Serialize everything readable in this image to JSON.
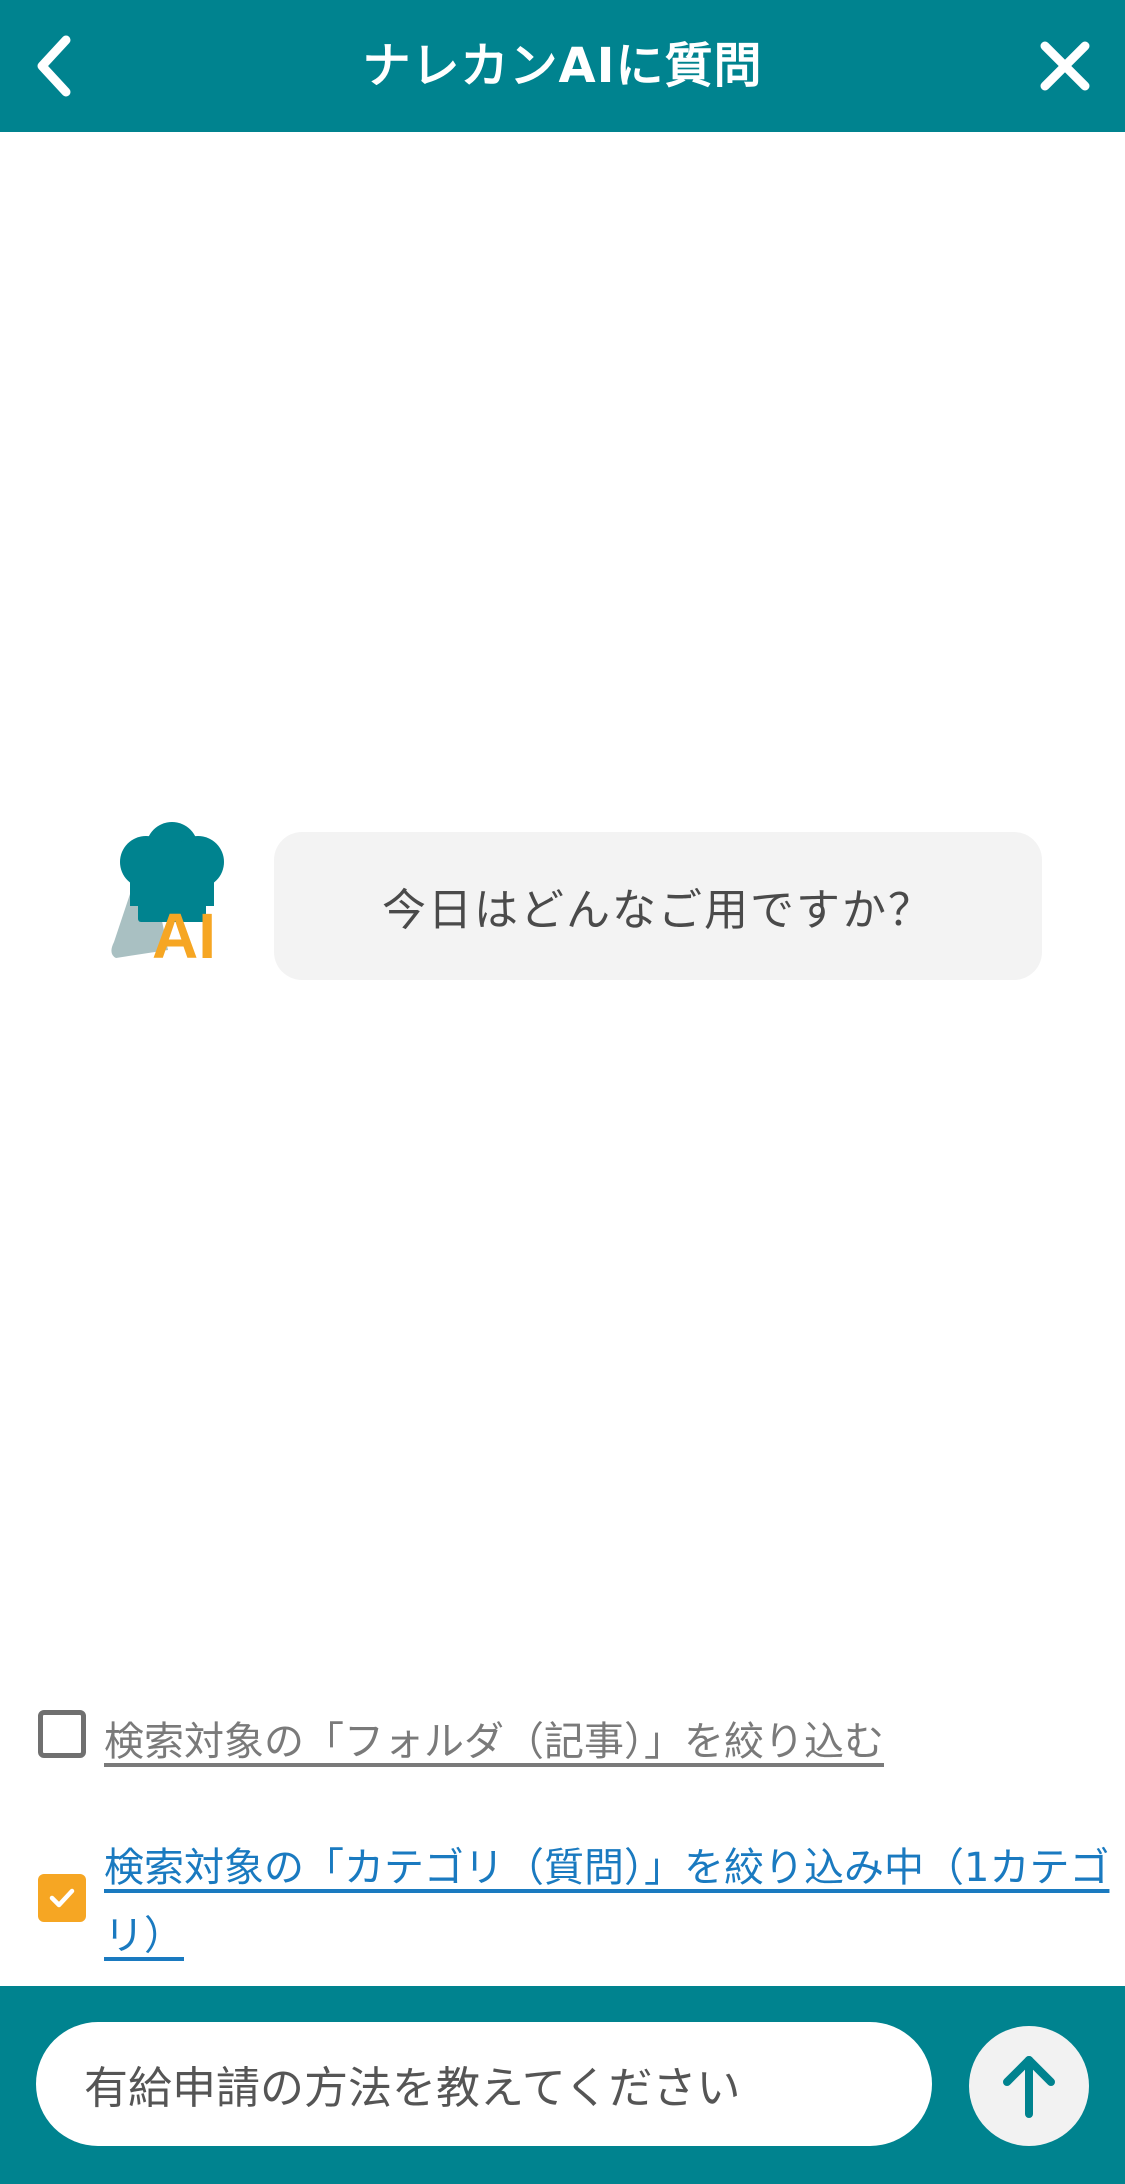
{
  "header": {
    "title": "ナレカンAIに質問",
    "back_icon": "chevron-left-icon",
    "close_icon": "close-icon",
    "background_color": "#00838f"
  },
  "chat": {
    "messages": [
      {
        "sender": "ai",
        "avatar_text": "AI",
        "text": "今日はどんなご用ですか？"
      }
    ]
  },
  "filters": {
    "folder": {
      "checked": false,
      "label": "検索対象の「フォルダ（記事）」を絞り込む"
    },
    "category": {
      "checked": true,
      "label": "検索対象の「カテゴリ（質問）」を絞り込み中（1カテゴリ）"
    },
    "checked_color": "#f6a623",
    "link_color": "#1a7ac0"
  },
  "input": {
    "value": "有給申請の方法を教えてください",
    "send_icon": "arrow-up-icon"
  }
}
